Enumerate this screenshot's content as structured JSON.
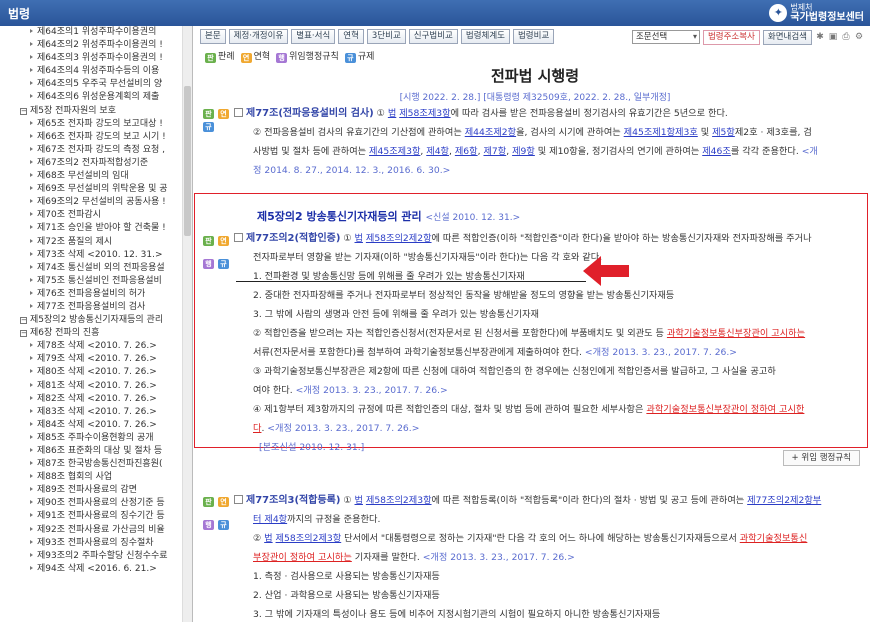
{
  "header": {
    "title": "법령",
    "logo_small": "법제처",
    "logo_large": "국가법령정보센터"
  },
  "tree": {
    "items": [
      {
        "t": "제64조의1 위성주파수이용권의",
        "lv": 1
      },
      {
        "t": "제64조의2 위성주파수이용권의 !",
        "lv": 1
      },
      {
        "t": "제64조의3 위성주파수이용권의 !",
        "lv": 1
      },
      {
        "t": "제64조의4 위성주파수등의 이용",
        "lv": 1
      },
      {
        "t": "제64조의5 우주국 무선설비의 양",
        "lv": 1
      },
      {
        "t": "제64조의6 위성운용계획의 제출",
        "lv": 1
      },
      {
        "t": "제5장 전파자원의 보호",
        "lv": 0
      },
      {
        "t": "제65조 전자파 강도의 보고대상 !",
        "lv": 1
      },
      {
        "t": "제66조 전자파 강도의 보고 시기 !",
        "lv": 1
      },
      {
        "t": "제67조 전자파 강도의 측정 요청 ,",
        "lv": 1
      },
      {
        "t": "제67조의2 전자파적합성기준",
        "lv": 1
      },
      {
        "t": "제68조 무선설비의 임대",
        "lv": 1
      },
      {
        "t": "제69조 무선설비의 위탁운용 및 공",
        "lv": 1
      },
      {
        "t": "제69조의2 무선설비의 공동사용 !",
        "lv": 1
      },
      {
        "t": "제70조 전파감시",
        "lv": 1
      },
      {
        "t": "제71조 승인을 받아야 할 건축물 !",
        "lv": 1
      },
      {
        "t": "제72조 품질의 제시",
        "lv": 1
      },
      {
        "t": "제73조 삭제 <2010. 12. 31.>",
        "lv": 1
      },
      {
        "t": "제74조 통신설비 외의 전파응용설",
        "lv": 1
      },
      {
        "t": "제75조 통신설비인 전파응용설비",
        "lv": 1
      },
      {
        "t": "제76조 전파응용설비의 허가",
        "lv": 1
      },
      {
        "t": "제77조 전파응용설비의 검사",
        "lv": 1
      },
      {
        "t": "제5장의2 방송통신기자재등의 관리",
        "lv": 0
      },
      {
        "t": "제6장 전파의 진흥",
        "lv": 0
      },
      {
        "t": "제78조 삭제 <2010. 7. 26.>",
        "lv": 1
      },
      {
        "t": "제79조 삭제 <2010. 7. 26.>",
        "lv": 1
      },
      {
        "t": "제80조 삭제 <2010. 7. 26.>",
        "lv": 1
      },
      {
        "t": "제81조 삭제 <2010. 7. 26.>",
        "lv": 1
      },
      {
        "t": "제82조 삭제 <2010. 7. 26.>",
        "lv": 1
      },
      {
        "t": "제83조 삭제 <2010. 7. 26.>",
        "lv": 1
      },
      {
        "t": "제84조 삭제 <2010. 7. 26.>",
        "lv": 1
      },
      {
        "t": "제85조 주파수이용현황의 공개",
        "lv": 1
      },
      {
        "t": "제86조 표준화의 대상 및 절차 등",
        "lv": 1
      },
      {
        "t": "제87조 한국방송통신전파진흥원(",
        "lv": 1
      },
      {
        "t": "제88조 협회의 사업",
        "lv": 1
      },
      {
        "t": "제89조 전파사용료의 감면",
        "lv": 1
      },
      {
        "t": "제90조 전파사용료의 산정기준 등",
        "lv": 1
      },
      {
        "t": "제91조 전파사용료의 징수기간 등",
        "lv": 1
      },
      {
        "t": "제92조 전파사용료 가산금의 비율",
        "lv": 1
      },
      {
        "t": "제93조 전파사용료의 징수절차",
        "lv": 1
      },
      {
        "t": "제93조의2 주파수할당 신청수수료",
        "lv": 1
      },
      {
        "t": "제94조 삭제 <2016. 6. 21.>",
        "lv": 1
      }
    ]
  },
  "toolbar": {
    "buttons": [
      "본문",
      "제정·개정이유",
      "별표·서식",
      "연혁",
      "3단비교",
      "신구법비교",
      "법령체계도",
      "법령비교"
    ],
    "select": "조문선택",
    "law_addr": "법령주소복사",
    "print": "화면내검색"
  },
  "legend": {
    "precedent": "판례",
    "history": "연혁",
    "delegation": "위임행정규칙",
    "rule": "규제"
  },
  "doc": {
    "title": "전파법 시행령",
    "subtitle": "[시행 2022. 2. 28.] [대통령령 제32509호, 2022. 2. 28., 일부개정]"
  },
  "a77": {
    "head": "제77조(전파응용설비의 검사)",
    "p1a": "①",
    "p1b": "법",
    "p1c": "제58조제3항",
    "p1d": "에 따라 검사를 받은 전파응용설비 정기검사의 유효기간은 5년으로 한다.",
    "p2a": "② 전파응용설비 검사의 유효기간의 기산점에 관하여는 ",
    "p2b": "제44조제2항",
    "p2c": "을, 검사의 시기에 관하여는 ",
    "p2d": "제45조제1항제3호",
    "p2e": " 및 ",
    "p2f": "제5항",
    "p2g": "제2호 · 제3호를, 검",
    "p3a": "사방법 및 절차 등에 관하여는 ",
    "p3b": "제45조제3항",
    "p3c": ", ",
    "p3d": "제4항",
    "p3e": ", ",
    "p3f": "제6항",
    "p3g": ", ",
    "p3h": "제7항",
    "p3i": ", ",
    "p3j": "제9항",
    "p3k": " 및 제10항을, 정기검사의 연기에 관하여는 ",
    "p3l": "제46조",
    "p3m": "를 각각 준용한다. ",
    "p3n": "<개",
    "p4": "정 2014. 8. 27., 2014. 12. 3., 2016. 6. 30.>"
  },
  "chapter": {
    "title": "제5장의2 방송통신기자재등의 관리",
    "amend": "<신설 2010. 12. 31.>"
  },
  "a77_2": {
    "head": "제77조의2(적합인증)",
    "l1a": " ① ",
    "l1b": "법",
    "l1c": "제58조의2제2항",
    "l1d": "에 따른 적합인증(이하 \"적합인증\"이라 한다)을 받아야 하는 방송통신기자재와 전자파장해를 주거나",
    "l2": "전자파로부터 영향을 받는 기자재(이하 \"방송통신기자재등\"이라 한다)는 다음 각 호와 같다.",
    "i1": "1. 전파환경 및 방송통신망 등에 위해를 줄 우려가 있는 방송통신기자재",
    "i2": "2. 중대한 전자파장해를 주거나 전자파로부터 정상적인 동작을 방해받을 정도의 영향을 받는 방송통신기자재등",
    "i3": "3. 그 밖에 사람의 생명과 안전 등에 위해를 줄 우려가 있는 방송통신기자재",
    "p2a": "② 적합인증을 받으려는 자는 적합인증신청서(전자문서로 된 신청서를 포함한다)에 부품배치도 및 외관도 등 ",
    "p2b": "과학기술정보통신부장관이 고시하는",
    "p2c": "서류(전자문서를 포함한다)를 첨부하여 과학기술정보통신부장관에게 제출하여야 한다. ",
    "p2d": "<개정 2013. 3. 23., 2017. 7. 26.>",
    "p3a": "③ 과학기술정보통신부장관은 제2항에 따른 신청에 대하여 적합인증의 한 경우에는 신청인에게 적합인증서를 발급하고, 그 사실을 공고하",
    "p3b": "여야 한다. ",
    "p3c": "<개정 2013. 3. 23., 2017. 7. 26.>",
    "p4a": "④ 제1항부터 제3항까지의 규정에 따른 적합인증의 대상, 절차 및 방법 등에 관하여 필요한 세부사항은 ",
    "p4b": "과학기술정보통신부장관이 정하여 고시한",
    "p4c": "다",
    "p4d": ". ",
    "p4e": "<개정 2013. 3. 23., 2017. 7. 26.>",
    "note": "[본조신설 2010. 12. 31.]"
  },
  "violation_btn": "위임 행정규칙",
  "a77_3": {
    "head": "제77조의3(적합등록)",
    "l1a": " ① ",
    "l1b": "법",
    "l1c": "제58조의2제3항",
    "l1d": "에 따른 적합등록(이하 \"적합등록\"이라 한다)의 절차 · 방법 및 공고 등에 관하여는 ",
    "l1e": "제77조의2제2항부",
    "l2a": "터 제4항",
    "l2b": "까지의 규정을 준용한다.",
    "p2a": "② ",
    "p2b": "법",
    "p2c": "제58조의2제3항",
    "p2d": " 단서에서 \"대통령령으로 정하는 기자재\"란 다음 각 호의 어느 하나에 해당하는 방송통신기자재등으로서 ",
    "p2e": "과학기술정보통신",
    "p2f": "부장관이 정하여 고시하는",
    "p2g": " 기자재를 말한다. ",
    "p2h": "<개정 2013. 3. 23., 2017. 7. 26.>",
    "i1": "1. 측정 · 검사용으로 사용되는 방송통신기자재등",
    "i2": "2. 산업 · 과학용으로 사용되는 방송통신기자재등",
    "i3": "3. 그 밖에 기자재의 특성이나 용도 등에 비추어 지정시험기관의 시험이 필요하지 아니한 방송통신기자재등"
  },
  "colors": {
    "accent": "#2a5599",
    "highlight": "#e0202a"
  }
}
